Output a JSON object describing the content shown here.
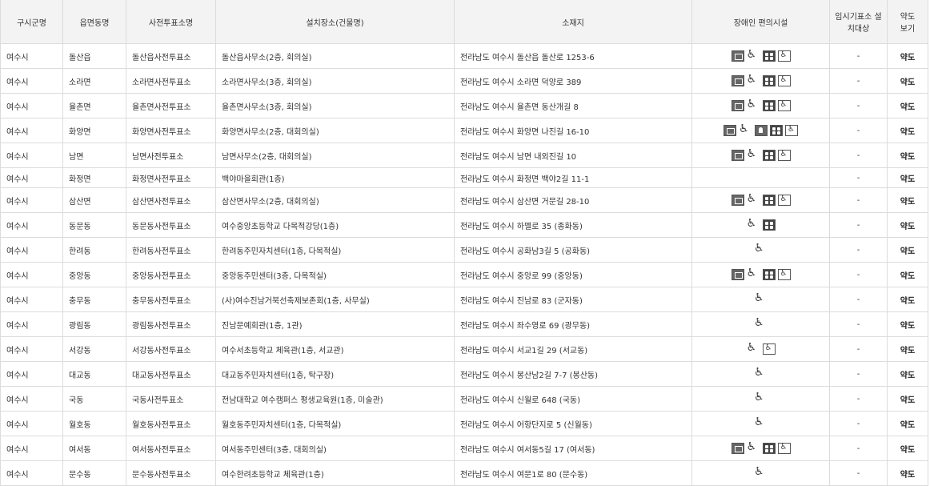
{
  "headers": [
    "구시군명",
    "읍면동명",
    "사전투표소명",
    "설치장소(건물명)",
    "소재지",
    "장애인 편의시설",
    "임시기표소 설치대상",
    "약도 보기"
  ],
  "rows": [
    {
      "sigungu": "여수시",
      "dong": "돌산읍",
      "station": "돌산읍사전투표소",
      "place": "돌산읍사무소(2층, 회의실)",
      "address": "전라남도 여수시 돌산읍 돌산로 1253-6",
      "temp": "-",
      "map": "약도",
      "icons": [
        "elevator-icon",
        "wheelchair-icon",
        "braille-icon",
        "wheelchair-box-icon"
      ]
    },
    {
      "sigungu": "여수시",
      "dong": "소라면",
      "station": "소라면사전투표소",
      "place": "소라면사무소(3층, 회의실)",
      "address": "전라남도 여수시 소라면 덕양로 389",
      "temp": "-",
      "map": "약도",
      "icons": [
        "elevator-icon",
        "wheelchair-icon",
        "braille-icon",
        "wheelchair-box-icon"
      ]
    },
    {
      "sigungu": "여수시",
      "dong": "율촌면",
      "station": "율촌면사전투표소",
      "place": "율촌면사무소(3층, 회의실)",
      "address": "전라남도 여수시 율촌면 동산개길 8",
      "temp": "-",
      "map": "약도",
      "icons": [
        "elevator-icon",
        "wheelchair-icon",
        "braille-icon",
        "wheelchair-box-icon"
      ]
    },
    {
      "sigungu": "여수시",
      "dong": "화양면",
      "station": "화양면사전투표소",
      "place": "화양면사무소(2층, 대회의실)",
      "address": "전라남도 여수시 화양면 나진길 16-10",
      "temp": "-",
      "map": "약도",
      "icons": [
        "elevator-icon",
        "wheelchair-icon",
        "bell-icon",
        "braille-icon",
        "wheelchair-box-icon"
      ]
    },
    {
      "sigungu": "여수시",
      "dong": "남면",
      "station": "남면사전투표소",
      "place": "남면사무소(2층, 대회의실)",
      "address": "전라남도 여수시 남면 내외진길 10",
      "temp": "-",
      "map": "약도",
      "icons": [
        "elevator-icon",
        "wheelchair-icon",
        "braille-icon",
        "wheelchair-box-icon"
      ]
    },
    {
      "sigungu": "여수시",
      "dong": "화정면",
      "station": "화정면사전투표소",
      "place": "백야마을회관(1층)",
      "address": "전라남도 여수시 화정면 백야2길 11-1",
      "temp": "-",
      "map": "약도",
      "icons": [],
      "short": true
    },
    {
      "sigungu": "여수시",
      "dong": "삼산면",
      "station": "삼산면사전투표소",
      "place": "삼산면사무소(2층, 대회의실)",
      "address": "전라남도 여수시 삼산면 거문길 28-10",
      "temp": "-",
      "map": "약도",
      "icons": [
        "elevator-icon",
        "wheelchair-icon",
        "braille-icon",
        "wheelchair-box-icon"
      ]
    },
    {
      "sigungu": "여수시",
      "dong": "동문동",
      "station": "동문동사전투표소",
      "place": "여수중앙초등학교 다목적강당(1층)",
      "address": "전라남도 여수시 하멜로 35 (종화동)",
      "temp": "-",
      "map": "약도",
      "icons": [
        "wheelchair-icon",
        "braille-icon"
      ]
    },
    {
      "sigungu": "여수시",
      "dong": "한려동",
      "station": "한려동사전투표소",
      "place": "한려동주민자치센터(1층, 다목적실)",
      "address": "전라남도 여수시 공화남3길 5 (공화동)",
      "temp": "-",
      "map": "약도",
      "icons": [
        "wheelchair-icon"
      ]
    },
    {
      "sigungu": "여수시",
      "dong": "중앙동",
      "station": "중앙동사전투표소",
      "place": "중앙동주민센터(3층, 다목적실)",
      "address": "전라남도 여수시 중앙로 99 (중앙동)",
      "temp": "-",
      "map": "약도",
      "icons": [
        "elevator-icon",
        "wheelchair-icon",
        "braille-icon",
        "wheelchair-box-icon"
      ]
    },
    {
      "sigungu": "여수시",
      "dong": "충무동",
      "station": "충무동사전투표소",
      "place": "(사)여수진남거북선축제보존회(1층, 사무실)",
      "address": "전라남도 여수시 진남로 83 (군자동)",
      "temp": "-",
      "map": "약도",
      "icons": [
        "wheelchair-icon"
      ]
    },
    {
      "sigungu": "여수시",
      "dong": "광림동",
      "station": "광림동사전투표소",
      "place": "진남문예회관(1층, 1관)",
      "address": "전라남도 여수시 좌수영로 69 (광무동)",
      "temp": "-",
      "map": "약도",
      "icons": [
        "wheelchair-icon"
      ]
    },
    {
      "sigungu": "여수시",
      "dong": "서강동",
      "station": "서강동사전투표소",
      "place": "여수서초등학교 체육관(1층, 서교관)",
      "address": "전라남도 여수시 서교1길 29 (서교동)",
      "temp": "-",
      "map": "약도",
      "icons": [
        "wheelchair-icon",
        "wheelchair-box-icon"
      ]
    },
    {
      "sigungu": "여수시",
      "dong": "대교동",
      "station": "대교동사전투표소",
      "place": "대교동주민자치센터(1층, 탁구장)",
      "address": "전라남도 여수시 봉산남2길 7-7 (봉산동)",
      "temp": "-",
      "map": "약도",
      "icons": [
        "wheelchair-icon"
      ]
    },
    {
      "sigungu": "여수시",
      "dong": "국동",
      "station": "국동사전투표소",
      "place": "전남대학교 여수캠퍼스 평생교육원(1층, 미술관)",
      "address": "전라남도 여수시 신월로 648 (국동)",
      "temp": "-",
      "map": "약도",
      "icons": [
        "wheelchair-icon"
      ]
    },
    {
      "sigungu": "여수시",
      "dong": "월호동",
      "station": "월호동사전투표소",
      "place": "월호동주민자치센터(1층, 다목적실)",
      "address": "전라남도 여수시 어항단지로 5 (신월동)",
      "temp": "-",
      "map": "약도",
      "icons": [
        "wheelchair-icon"
      ]
    },
    {
      "sigungu": "여수시",
      "dong": "여서동",
      "station": "여서동사전투표소",
      "place": "여서동주민센터(3층, 대회의실)",
      "address": "전라남도 여수시 여서동5길 17 (여서동)",
      "temp": "-",
      "map": "약도",
      "icons": [
        "elevator-icon",
        "wheelchair-icon",
        "braille-icon",
        "wheelchair-box-icon"
      ]
    },
    {
      "sigungu": "여수시",
      "dong": "문수동",
      "station": "문수동사전투표소",
      "place": "여수한려초등학교 체육관(1층)",
      "address": "전라남도 여수시 여문1로 80 (문수동)",
      "temp": "-",
      "map": "약도",
      "icons": [
        "wheelchair-icon"
      ]
    }
  ]
}
